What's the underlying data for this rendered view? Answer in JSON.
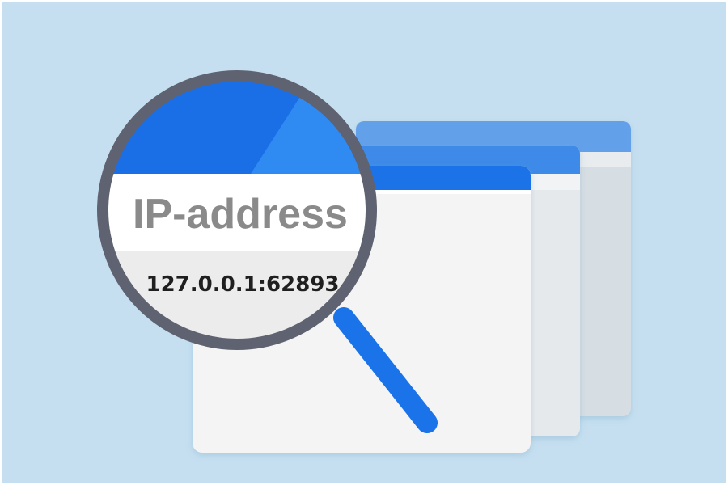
{
  "illustration": {
    "lens_title": "IP-address",
    "lens_value": "127.0.0.1:62893",
    "icon": "magnifying-glass-icon"
  },
  "colors": {
    "background": "#c5dff0",
    "window_blue": "#1a73e8",
    "window_blue_light": "#62a0ea",
    "window_body": "#f4f4f4",
    "lens_rim": "#5f6270",
    "handle": "#1a73e8"
  }
}
